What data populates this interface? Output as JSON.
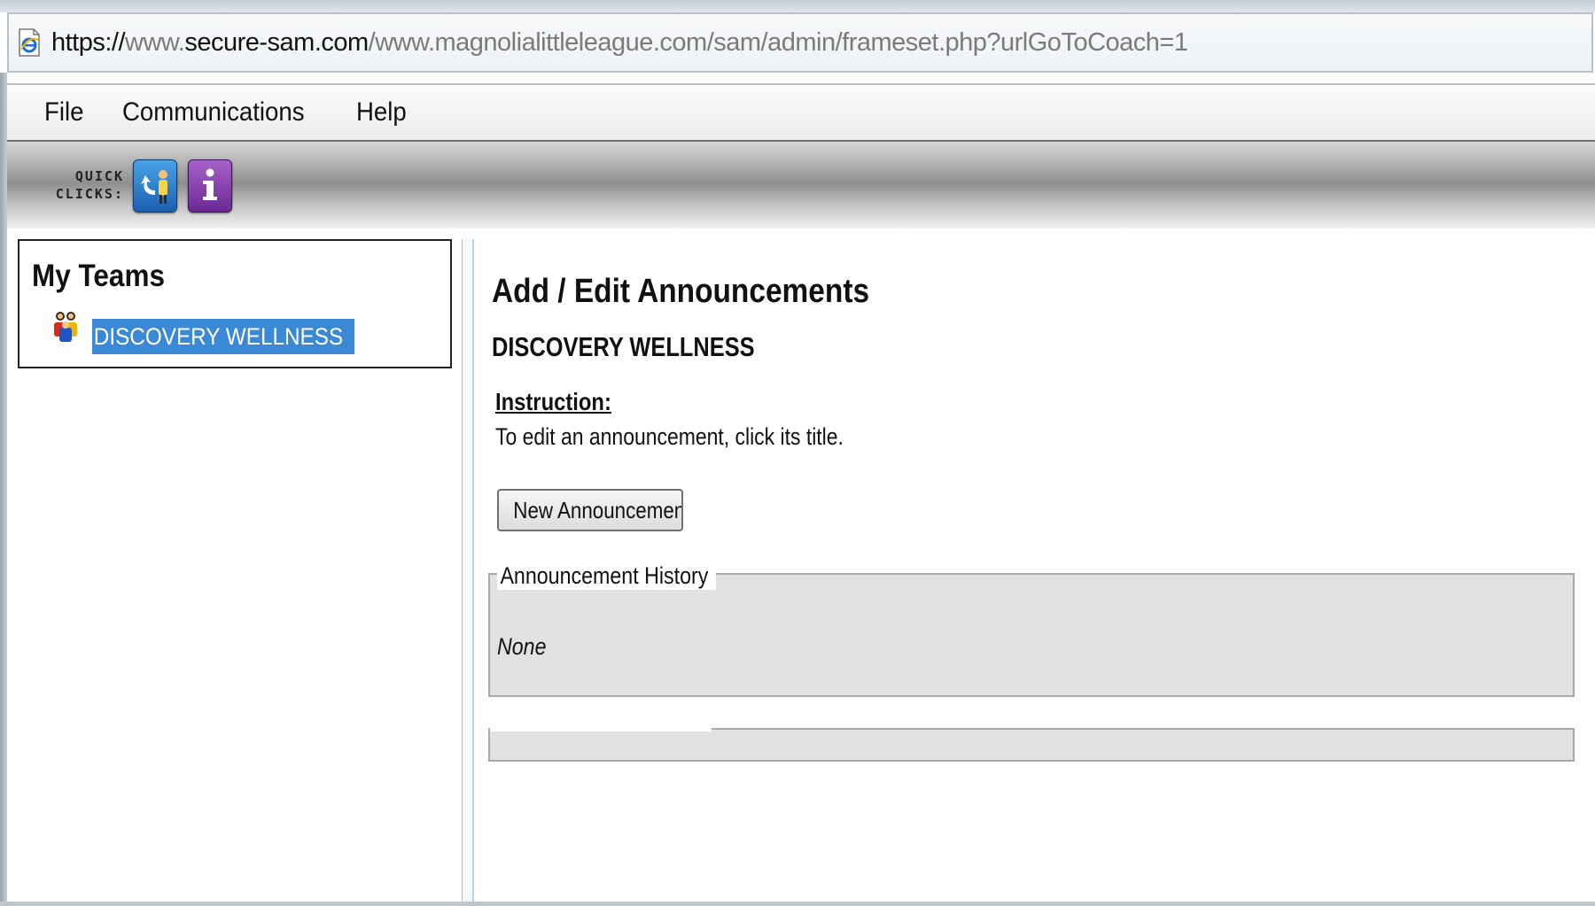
{
  "browser": {
    "url_prefix": "https://",
    "url_host_dim": "www.",
    "url_host": "secure-sam.com",
    "url_path": "/www.magnolialittleleague.com/sam/admin/frameset.php?urlGoToCoach=1"
  },
  "menu": {
    "items": [
      {
        "label": "File"
      },
      {
        "label": "Communications"
      },
      {
        "label": "Help"
      }
    ]
  },
  "toolbar": {
    "quick_label_line1": "QUICK",
    "quick_label_line2": "CLICKS:",
    "buttons": [
      {
        "icon": "coach-back-icon",
        "color": "#1b5fb0"
      },
      {
        "icon": "info-icon",
        "color": "#6a2a93"
      }
    ]
  },
  "sidebar": {
    "title": "My Teams",
    "teams": [
      {
        "name": "DISCOVERY WELLNESS",
        "icon": "team-people-icon",
        "selected": true
      }
    ]
  },
  "main": {
    "title": "Add / Edit Announcements",
    "team_name": "DISCOVERY WELLNESS",
    "instruction_label": "Instruction:",
    "instruction_text": "To edit an announcement, click its title.",
    "new_button_label": "New Announcement",
    "history_legend": "Announcement History",
    "history_empty_text": "None"
  },
  "colors": {
    "selection_highlight": "#3a88d6",
    "fieldset_bg": "#e2e2e2"
  }
}
